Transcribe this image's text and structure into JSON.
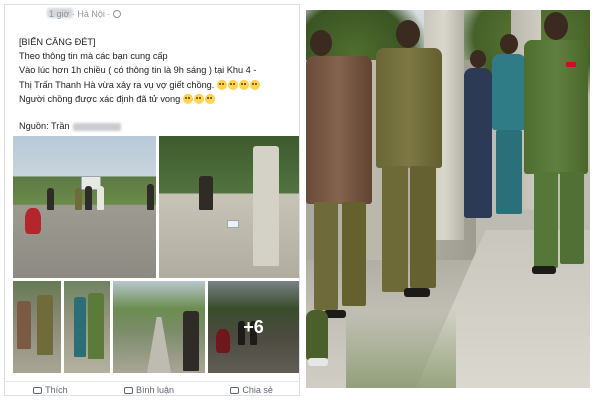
{
  "post": {
    "meta": "1 giờ · Hà Nội ·",
    "lines": [
      "[BIẾN CĂNG ĐÉT]",
      "Theo thông tin mà các bạn cung cấp",
      "Vào lúc hơn 1h chiều ( có thông tin là 9h sáng ) tại Khu 4 -",
      "Thị Trấn Thanh Hà vừa xảy ra vụ vợ giết chồng.",
      "Người chồng được xác định đã tử vong"
    ],
    "source_label": "Nguồn: Trần",
    "more_photos": "+6",
    "actions": [
      "Thích",
      "Bình luận",
      "Chia sẻ"
    ]
  },
  "icons": {
    "globe": "globe-icon",
    "emoji": "face-screaming-emoji-icon",
    "emoji_cry": "face-crying-emoji-icon",
    "like": "like-icon",
    "comment": "comment-icon",
    "share": "share-icon"
  },
  "colors": {
    "text": "#1c1e21",
    "meta": "#90949c",
    "divider": "#dddfe2",
    "uniform_olive": "#6f6b3a",
    "uniform_green": "#5c7a3a",
    "badge_red": "#c8102e"
  }
}
